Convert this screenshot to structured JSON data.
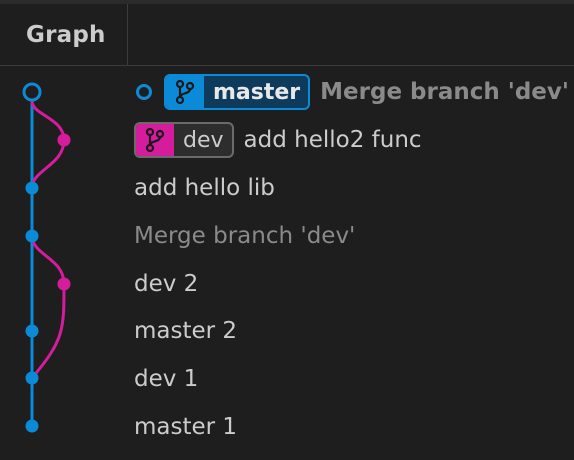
{
  "header": {
    "graph_label": "Graph"
  },
  "colors": {
    "master_lane": "#0b8ad8",
    "dev_lane": "#d41c9c",
    "background": "#1e1e1e"
  },
  "refs": {
    "master": {
      "label": "master",
      "icon": "branch-icon"
    },
    "dev": {
      "label": "dev",
      "icon": "branch-icon"
    }
  },
  "commits": [
    {
      "message": "Merge branch 'dev'",
      "ref": "master",
      "head": true
    },
    {
      "message": "add hello2 func",
      "ref": "dev"
    },
    {
      "message": "add hello lib"
    },
    {
      "message": "Merge branch 'dev'"
    },
    {
      "message": "dev 2"
    },
    {
      "message": "master 2"
    },
    {
      "message": "dev 1"
    },
    {
      "message": "master 1"
    }
  ]
}
